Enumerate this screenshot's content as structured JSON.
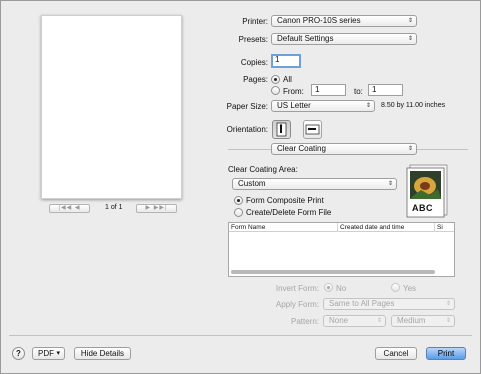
{
  "printer": {
    "label": "Printer:",
    "value": "Canon PRO-10S series"
  },
  "presets": {
    "label": "Presets:",
    "value": "Default Settings"
  },
  "copies": {
    "label": "Copies:",
    "value": "1"
  },
  "pages": {
    "label": "Pages:",
    "all": "All",
    "from_label": "From:",
    "from_value": "1",
    "to_label": "to:",
    "to_value": "1",
    "selected": "All"
  },
  "paper_size": {
    "label": "Paper Size:",
    "value": "US Letter",
    "dimensions": "8.50 by 11.00 inches"
  },
  "orientation": {
    "label": "Orientation:",
    "selected": "portrait"
  },
  "section_popup": "Clear Coating",
  "clear_coating": {
    "area_label": "Clear Coating Area:",
    "area_value": "Custom",
    "form_composite_print": "Form Composite Print",
    "create_delete_form_file": "Create/Delete Form File",
    "selected": "Form Composite Print",
    "preview_text": "ABC"
  },
  "form_table": {
    "columns": [
      "Form Name",
      "Created date and time",
      "Si"
    ],
    "rows": []
  },
  "invert_form": {
    "label": "Invert Form:",
    "no": "No",
    "yes": "Yes",
    "selected": "No"
  },
  "apply_form": {
    "label": "Apply Form:",
    "value": "Same to All Pages"
  },
  "pattern": {
    "label": "Pattern:",
    "value": "None",
    "density": "Medium"
  },
  "preview": {
    "page_indicator": "1 of 1",
    "first_prev": "|◀◀ ◀",
    "next_last": "▶ ▶▶|"
  },
  "footer": {
    "help": "?",
    "pdf": "PDF",
    "hide_details": "Hide Details",
    "cancel": "Cancel",
    "print": "Print"
  },
  "icons": {
    "popup_arrows": "⇕",
    "dropdown": "▾",
    "portrait": "portrait-orientation-icon",
    "landscape": "landscape-orientation-icon"
  },
  "colors": {
    "accent": "#5a9ce9",
    "focus": "#6fa0de",
    "window": "#ececec"
  }
}
